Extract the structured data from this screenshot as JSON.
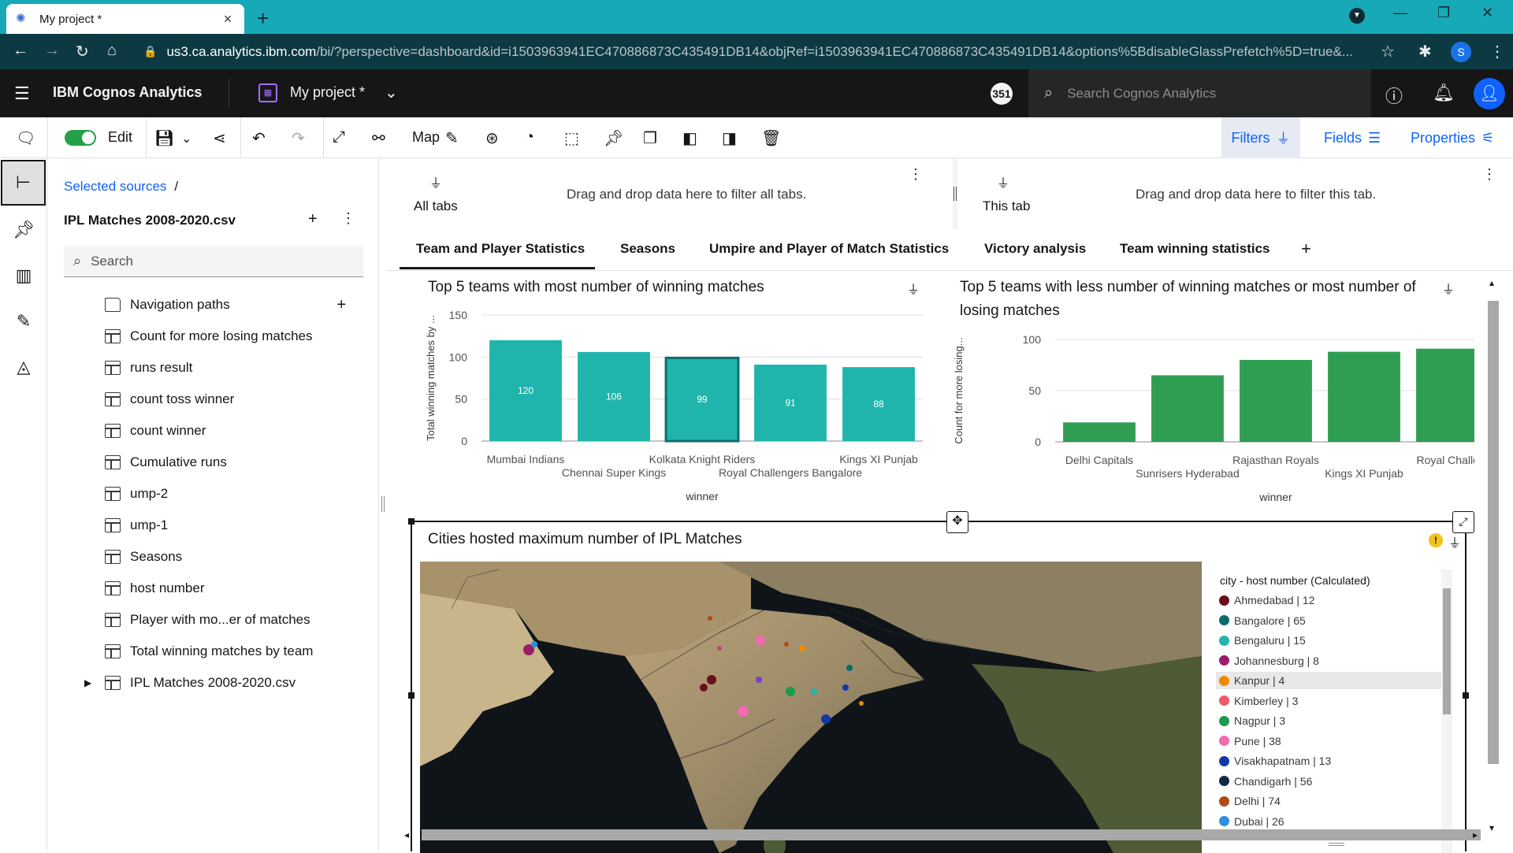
{
  "browser": {
    "tab_title": "My project *",
    "url_host": "us3.ca.analytics.ibm.com",
    "url_path": "/bi/?perspective=dashboard&id=i1503963941EC470886873C435491DB14&objRef=i1503963941EC470886873C435491DB14&options%5BdisableGlassPrefetch%5D=true&...",
    "profile_initial": "S"
  },
  "header": {
    "product": "IBM Cognos Analytics",
    "project_name": "My project *",
    "notification_count": "351",
    "search_placeholder": "Search Cognos Analytics"
  },
  "toolbar": {
    "edit_label": "Edit",
    "map_label": "Map",
    "filters_label": "Filters",
    "fields_label": "Fields",
    "properties_label": "Properties"
  },
  "sources": {
    "breadcrumb": "Selected sources",
    "breadcrumb_sep": "/",
    "title": "IPL Matches 2008-2020.csv",
    "search_placeholder": "Search",
    "items": [
      {
        "label": "Navigation paths",
        "icon": "folder-icon"
      },
      {
        "label": "Count for more losing matches",
        "icon": "table-icon"
      },
      {
        "label": "runs result",
        "icon": "table-icon"
      },
      {
        "label": "count toss winner",
        "icon": "table-icon"
      },
      {
        "label": "count winner",
        "icon": "table-icon"
      },
      {
        "label": "Cumulative runs",
        "icon": "table-icon"
      },
      {
        "label": "ump-2",
        "icon": "table-icon"
      },
      {
        "label": "ump-1",
        "icon": "table-icon"
      },
      {
        "label": "Seasons",
        "icon": "table-icon"
      },
      {
        "label": "host number",
        "icon": "table-icon"
      },
      {
        "label": "Player with mo...er of matches",
        "icon": "table-icon"
      },
      {
        "label": "Total winning matches by team",
        "icon": "table-icon"
      },
      {
        "label": "IPL Matches 2008-2020.csv",
        "icon": "table-icon"
      }
    ]
  },
  "filters": {
    "all_tabs_label": "All tabs",
    "all_tabs_hint": "Drag and drop data here to filter all tabs.",
    "this_tab_label": "This tab",
    "this_tab_hint": "Drag and drop data here to filter this tab."
  },
  "tabs": [
    "Team and Player Statistics",
    "Seasons",
    "Umpire and Player of Match Statistics",
    "Victory analysis",
    "Team winning statistics"
  ],
  "active_tab": "Team and Player Statistics",
  "chart_data": [
    {
      "type": "bar",
      "title": "Top 5 teams with most number of winning matches",
      "xlabel": "winner",
      "ylabel": "Total winning matches by ...",
      "categories": [
        "Mumbai Indians",
        "Chennai Super Kings",
        "Kolkata Knight Riders",
        "Royal Challengers Bangalore",
        "Kings XI Punjab"
      ],
      "values": [
        120,
        106,
        99,
        91,
        88
      ],
      "ylim": [
        0,
        150
      ],
      "yticks": [
        0,
        50,
        100,
        150
      ],
      "color": "#1fb5ac",
      "selected_color": "#0e6e6a",
      "data_labels": true
    },
    {
      "type": "bar",
      "title": "Top 5 teams with less number of winning matches or most number of losing matches",
      "xlabel": "winner",
      "ylabel": "Count for more losing...",
      "categories": [
        "Delhi Capitals",
        "Sunrisers Hyderabad",
        "Rajasthan Royals",
        "Kings XI Punjab",
        "Royal Challe..."
      ],
      "values": [
        19,
        65,
        80,
        88,
        91
      ],
      "ylim": [
        0,
        100
      ],
      "yticks": [
        0,
        50,
        100
      ],
      "color": "#2f9e52",
      "data_labels": false
    }
  ],
  "map": {
    "title": "Cities hosted maximum number of IPL Matches",
    "legend_title": "city - host number (Calculated)",
    "legend": [
      {
        "label": "Ahmedabad | 12",
        "color": "#6b0f1a"
      },
      {
        "label": "Bangalore | 65",
        "color": "#0b6b6b"
      },
      {
        "label": "Bengaluru | 15",
        "color": "#1fb5ac"
      },
      {
        "label": "Johannesburg | 8",
        "color": "#9b1d6a"
      },
      {
        "label": "Kanpur | 4",
        "color": "#f08a00"
      },
      {
        "label": "Kimberley | 3",
        "color": "#f25a6b"
      },
      {
        "label": "Nagpur | 3",
        "color": "#1a9b4a"
      },
      {
        "label": "Pune | 38",
        "color": "#f06bb0"
      },
      {
        "label": "Visakhapatnam | 13",
        "color": "#1238a8"
      },
      {
        "label": "Chandigarh | 56",
        "color": "#0e2a45"
      },
      {
        "label": "Delhi | 74",
        "color": "#b14a14"
      },
      {
        "label": "Dubai | 26",
        "color": "#2d8fe0"
      }
    ],
    "highlighted": "Kanpur | 4"
  }
}
